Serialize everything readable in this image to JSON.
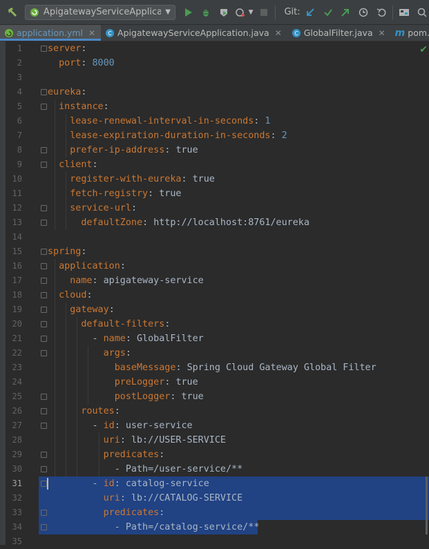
{
  "toolbar": {
    "run_config": "ApigatewayServiceApplication",
    "git_label": "Git:"
  },
  "tabs": [
    {
      "label": "application.yml",
      "active": true,
      "type": "yml"
    },
    {
      "label": "ApigatewayServiceApplication.java",
      "active": false,
      "type": "java"
    },
    {
      "label": "GlobalFilter.java",
      "active": false,
      "type": "java"
    },
    {
      "label": "pom.xml (ap",
      "active": false,
      "type": "maven"
    }
  ],
  "editor": {
    "lines": [
      {
        "n": "1",
        "indent": 0,
        "key": "server",
        "val": ""
      },
      {
        "n": "2",
        "indent": 2,
        "key": "port",
        "val": "8000",
        "num": true
      },
      {
        "n": "3",
        "indent": 0,
        "key": "",
        "val": ""
      },
      {
        "n": "4",
        "indent": 0,
        "key": "eureka",
        "val": ""
      },
      {
        "n": "5",
        "indent": 2,
        "key": "instance",
        "val": ""
      },
      {
        "n": "6",
        "indent": 4,
        "key": "lease-renewal-interval-in-seconds",
        "val": "1",
        "num": true
      },
      {
        "n": "7",
        "indent": 4,
        "key": "lease-expiration-duration-in-seconds",
        "val": "2",
        "num": true
      },
      {
        "n": "8",
        "indent": 4,
        "key": "prefer-ip-address",
        "val": "true"
      },
      {
        "n": "9",
        "indent": 2,
        "key": "client",
        "val": ""
      },
      {
        "n": "10",
        "indent": 4,
        "key": "register-with-eureka",
        "val": "true"
      },
      {
        "n": "11",
        "indent": 4,
        "key": "fetch-registry",
        "val": "true"
      },
      {
        "n": "12",
        "indent": 4,
        "key": "service-url",
        "val": ""
      },
      {
        "n": "13",
        "indent": 6,
        "key": "defaultZone",
        "val": "http://localhost:8761/eureka"
      },
      {
        "n": "14",
        "indent": 0,
        "key": "",
        "val": ""
      },
      {
        "n": "15",
        "indent": 0,
        "key": "spring",
        "val": ""
      },
      {
        "n": "16",
        "indent": 2,
        "key": "application",
        "val": ""
      },
      {
        "n": "17",
        "indent": 4,
        "key": "name",
        "val": "apigateway-service"
      },
      {
        "n": "18",
        "indent": 2,
        "key": "cloud",
        "val": ""
      },
      {
        "n": "19",
        "indent": 4,
        "key": "gateway",
        "val": ""
      },
      {
        "n": "20",
        "indent": 6,
        "key": "default-filters",
        "val": ""
      },
      {
        "n": "21",
        "indent": 8,
        "dash": true,
        "key": "name",
        "val": "GlobalFilter"
      },
      {
        "n": "22",
        "indent": 10,
        "key": "args",
        "val": ""
      },
      {
        "n": "23",
        "indent": 12,
        "key": "baseMessage",
        "val": "Spring Cloud Gateway Global Filter"
      },
      {
        "n": "24",
        "indent": 12,
        "key": "preLogger",
        "val": "true"
      },
      {
        "n": "25",
        "indent": 12,
        "key": "postLogger",
        "val": "true"
      },
      {
        "n": "26",
        "indent": 6,
        "key": "routes",
        "val": ""
      },
      {
        "n": "27",
        "indent": 8,
        "dash": true,
        "key": "id",
        "val": "user-service"
      },
      {
        "n": "28",
        "indent": 10,
        "key": "uri",
        "val": "lb://USER-SERVICE"
      },
      {
        "n": "29",
        "indent": 10,
        "key": "predicates",
        "val": ""
      },
      {
        "n": "30",
        "indent": 12,
        "dash": true,
        "key": "",
        "val": "Path=/user-service/**"
      },
      {
        "n": "31",
        "indent": 8,
        "dash": true,
        "key": "id",
        "val": "catalog-service",
        "sel": true
      },
      {
        "n": "32",
        "indent": 10,
        "key": "uri",
        "val": "lb://CATALOG-SERVICE",
        "sel": true
      },
      {
        "n": "33",
        "indent": 10,
        "key": "predicates",
        "val": "",
        "sel": true
      },
      {
        "n": "34",
        "indent": 12,
        "dash": true,
        "key": "",
        "val": "Path=/catalog-service/**",
        "sel": true,
        "selpartial": true
      },
      {
        "n": "35",
        "indent": 0,
        "key": "",
        "val": ""
      }
    ]
  },
  "colors": {
    "background": "#2b2b2b",
    "keyword": "#cc7832",
    "number": "#6897bb",
    "text": "#a9b7c6",
    "selection": "#214283",
    "accent": "#4a88c7"
  }
}
